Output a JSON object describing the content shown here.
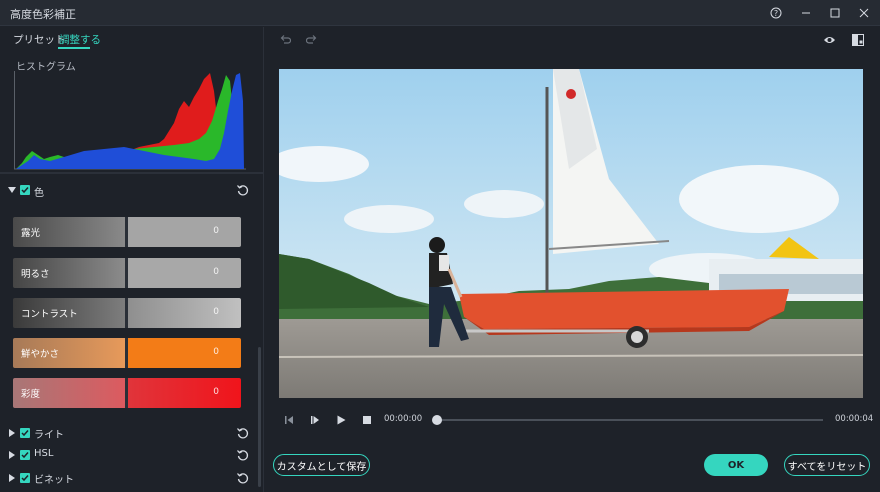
{
  "window": {
    "title": "高度色彩補正"
  },
  "tabs": [
    {
      "label": "プリセット"
    },
    {
      "label": "調整する"
    }
  ],
  "histogram": {
    "label": "ヒストグラム"
  },
  "color_section": {
    "label": "色"
  },
  "sliders": [
    {
      "label": "露光",
      "value": "0"
    },
    {
      "label": "明るさ",
      "value": "0"
    },
    {
      "label": "コントラスト",
      "value": "0"
    },
    {
      "label": "鮮やかさ",
      "value": "0"
    },
    {
      "label": "彩度",
      "value": "0"
    }
  ],
  "subsections": [
    {
      "label": "ライト"
    },
    {
      "label": "HSL"
    },
    {
      "label": "ビネット"
    }
  ],
  "player": {
    "current_time": "00:00:00",
    "duration": "00:00:04",
    "progress": 0
  },
  "buttons": {
    "save_custom": "カスタムとして保存",
    "ok": "OK",
    "reset_all": "すべてをリセット"
  },
  "colors": {
    "accent": "#35d6bf",
    "background": "#1e2229",
    "saturation_red": "#f0141b",
    "vibrance_orange": "#f37c17"
  },
  "icons": [
    "help-icon",
    "minimize-icon",
    "maximize-icon",
    "close-icon",
    "undo-icon",
    "redo-icon",
    "eye-icon",
    "compare-icon",
    "reset-icon",
    "prev-frame-icon",
    "next-frame-icon",
    "play-icon",
    "stop-icon"
  ]
}
